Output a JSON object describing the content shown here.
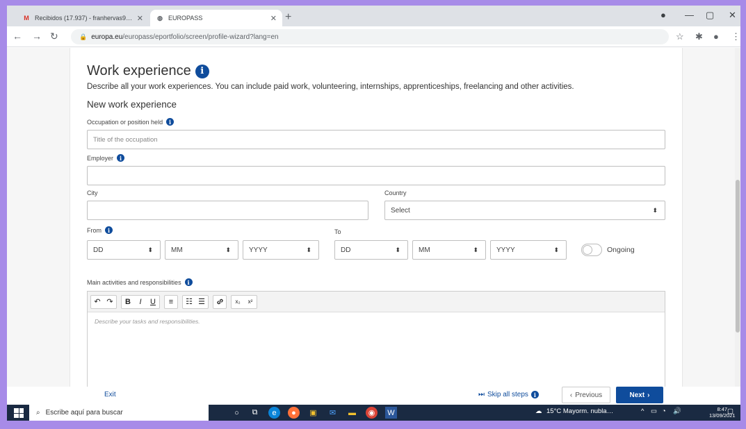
{
  "browser": {
    "tabs": [
      {
        "title": "Recibidos (17.937) - franhervas9…",
        "icon": "gmail-icon"
      },
      {
        "title": "EUROPASS",
        "icon": "europass-icon"
      }
    ],
    "new_tab": "+",
    "url_host": "europa.eu",
    "url_path": "/europass/eportfolio/screen/profile-wizard?lang=en"
  },
  "form": {
    "title": "Work experience",
    "description": "Describe all your work experiences. You can include paid work, volunteering, internships, apprenticeships, freelancing and other activities.",
    "subtitle": "New work experience",
    "occupation_label": "Occupation or position held",
    "occupation_placeholder": "Title of the occupation",
    "employer_label": "Employer",
    "city_label": "City",
    "country_label": "Country",
    "country_value": "Select",
    "from_label": "From",
    "to_label": "To",
    "dd": "DD",
    "mm": "MM",
    "yyyy": "YYYY",
    "ongoing_label": "Ongoing",
    "ongoing_on": false,
    "activities_label": "Main activities and responsibilities",
    "activities_placeholder": "Describe your tasks and responsibilities.",
    "editor_buttons": [
      "↶",
      "↷",
      "B",
      "I",
      "U",
      "≡",
      "☷",
      "☰",
      "🔗",
      "x₂",
      "x²"
    ]
  },
  "footer": {
    "exit": "Exit",
    "skip": "Skip all steps",
    "previous": "Previous",
    "next": "Next"
  },
  "taskbar": {
    "search_placeholder": "Escribe aquí para buscar",
    "weather": "15°C  Mayorm. nubla…",
    "time": "8:47",
    "date": "13/09/2021"
  }
}
